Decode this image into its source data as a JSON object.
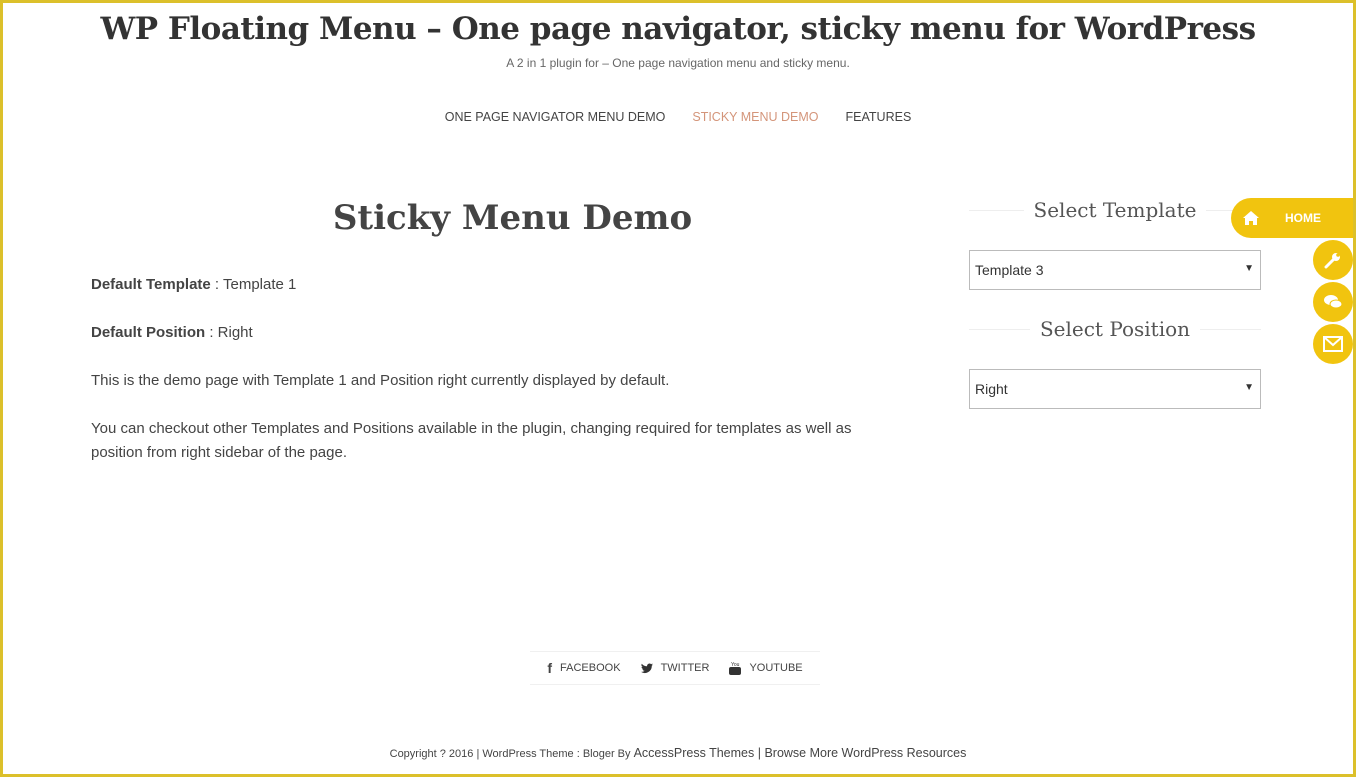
{
  "header": {
    "title": "WP Floating Menu – One page navigator, sticky menu for WordPress",
    "tagline": "A 2 in 1 plugin for – One page navigation menu and sticky menu."
  },
  "nav": [
    {
      "label": "ONE PAGE NAVIGATOR MENU DEMO"
    },
    {
      "label": "STICKY MENU DEMO",
      "active": true
    },
    {
      "label": "FEATURES"
    }
  ],
  "main": {
    "title": "Sticky Menu Demo",
    "default_template_label": "Default Template",
    "default_template_value": " : Template 1",
    "default_position_label": "Default Position",
    "default_position_value": " : Right",
    "p1": "This is the demo page with Template 1 and Position right currently displayed by default.",
    "p2": "You can checkout other Templates and Positions available in the plugin, changing required for templates as well as position from right sidebar of the page."
  },
  "sidebar": {
    "template_heading": "Select Template",
    "template_value": "Template 3",
    "position_heading": "Select Position",
    "position_value": "Right"
  },
  "floating_menu": {
    "color": "#f1c40f",
    "items": [
      {
        "label": "HOME",
        "icon": "home-icon"
      },
      {
        "icon": "wrench-icon"
      },
      {
        "icon": "chat-icon"
      },
      {
        "icon": "envelope-icon"
      }
    ]
  },
  "social": [
    {
      "label": "FACEBOOK",
      "icon": "facebook-icon"
    },
    {
      "label": "TWITTER",
      "icon": "twitter-icon"
    },
    {
      "label": "YOUTUBE",
      "icon": "youtube-icon"
    }
  ],
  "footer": {
    "copyright": "Copyright ? 2016 | WordPress Theme : Bloger By ",
    "theme_link": "AccessPress Themes",
    "separator": " | ",
    "resources_link": "Browse More WordPress Resources"
  }
}
